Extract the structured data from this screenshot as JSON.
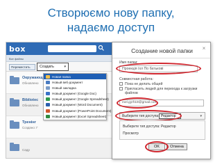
{
  "slide": {
    "title_line1": "Створюємо нову папку,",
    "title_line2": "надаємо доступ"
  },
  "box_app": {
    "logo": "box",
    "breadcrumb": "Все файлы",
    "move_button": "Переместить",
    "create_button": "Создать",
    "files": [
      {
        "name": "Окружающ",
        "meta": "Обновлено"
      },
      {
        "name": "Bibliotec",
        "meta": "Обновлено"
      },
      {
        "name": "Тренінг",
        "meta": "Создано: Г"
      },
      {
        "name": "",
        "meta": "Садр"
      }
    ],
    "menu": [
      {
        "label": "Новая папка",
        "highlighted": true,
        "icon_color": "#f2c04a"
      },
      {
        "label": "Новый веб-документ",
        "highlighted": false,
        "icon_color": "#4a7cc2"
      },
      {
        "label": "Новый закладка",
        "highlighted": false,
        "icon_color": "#7b9cc8"
      },
      {
        "label": "Новый документ (Google Doc)",
        "highlighted": false,
        "icon_color": "#3b73c7"
      },
      {
        "label": "Новый документ (Google Spreadsheet)",
        "highlighted": false,
        "icon_color": "#2f9a4a"
      },
      {
        "label": "Новый документ (Word Document)",
        "highlighted": false,
        "icon_color": "#2b5fad"
      },
      {
        "label": "Новый документ (PowerPoint Document)",
        "highlighted": false,
        "icon_color": "#d0562b"
      },
      {
        "label": "Новый документ (Excel Spreadsheet)",
        "highlighted": false,
        "icon_color": "#2f8a3f"
      }
    ]
  },
  "dialog": {
    "title": "Создание новой папки",
    "name_label": "Имя папки:",
    "name_value": "Проекція їхл По батькові",
    "collab_label": "Совместная работа:",
    "option1": "Пока не делать общей",
    "option2": "Пригласить людей для перехода к загрузки файлов",
    "email_value": "mel.gyrh19@gmail.com",
    "role_label": "Выберите тип доступа:",
    "role_value": "Редактор",
    "perm_line1": "Выберите тип доступа: Редактор",
    "perm_line2": "Просмотр",
    "ok": "OK",
    "cancel": "Отмена"
  },
  "colors": {
    "title_blue": "#1f6fb2",
    "box_blue": "#2f6bb5",
    "highlight_red": "#d0262e"
  }
}
